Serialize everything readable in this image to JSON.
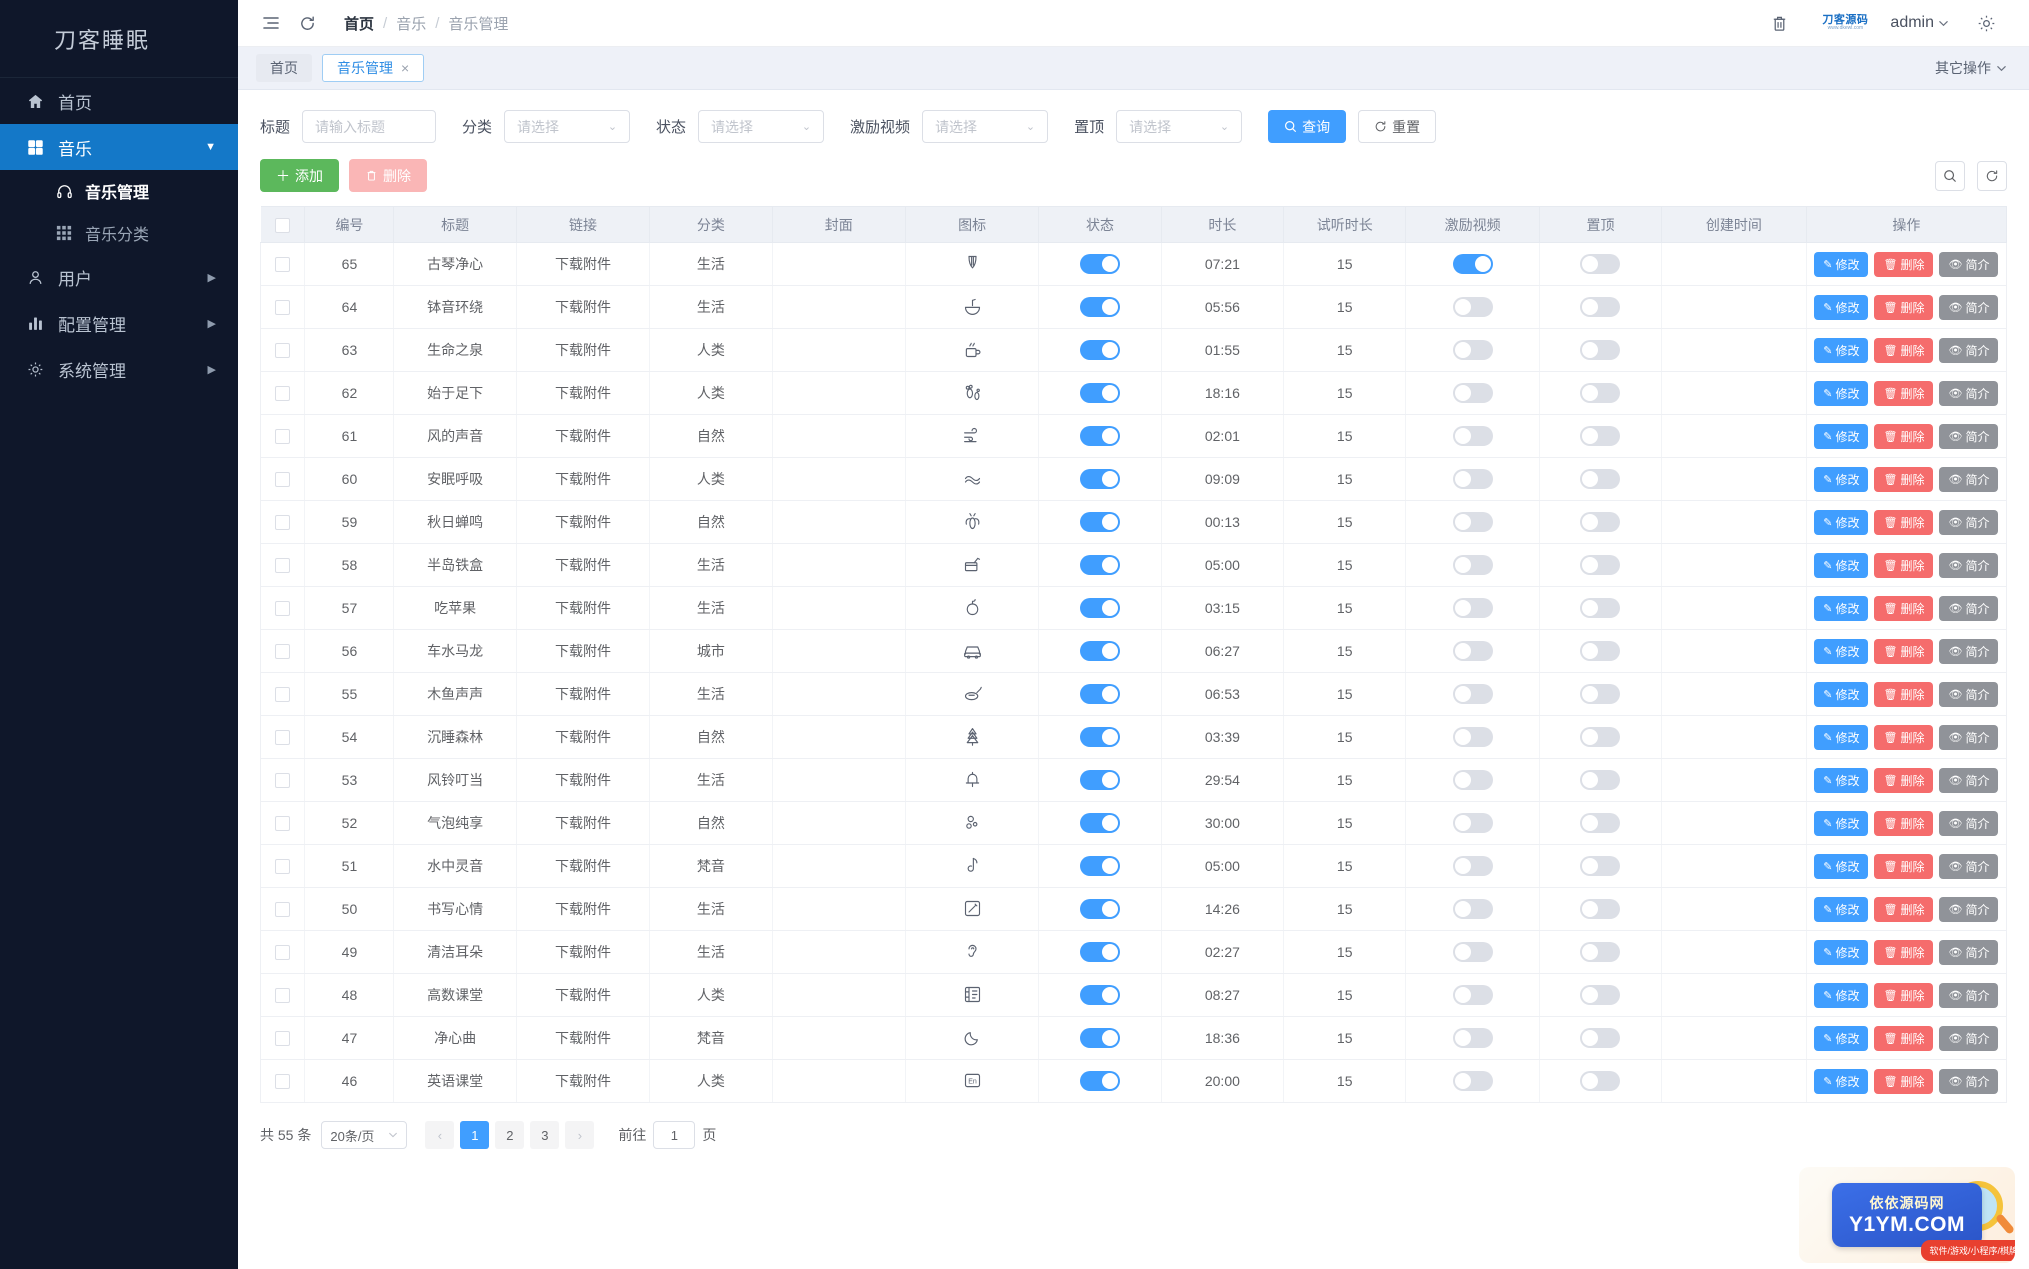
{
  "sidebar": {
    "brand": "刀客睡眠",
    "items": [
      {
        "label": "首页",
        "icon": "home-icon",
        "active": false,
        "arrow": ""
      },
      {
        "label": "音乐",
        "icon": "grid-icon",
        "active": true,
        "arrow": "▼"
      },
      {
        "label": "用户",
        "icon": "user-icon",
        "active": false,
        "arrow": "▶"
      },
      {
        "label": "配置管理",
        "icon": "chart-icon",
        "active": false,
        "arrow": "▶"
      },
      {
        "label": "系统管理",
        "icon": "gear-icon",
        "active": false,
        "arrow": "▶"
      }
    ],
    "sub_items": [
      {
        "label": "音乐管理",
        "icon": "headphone-icon",
        "current": true
      },
      {
        "label": "音乐分类",
        "icon": "grid-small-icon",
        "current": false
      }
    ]
  },
  "topbar": {
    "menu_icon": "hamburger-icon",
    "refresh_icon": "refresh-icon",
    "breadcrumb": [
      "首页",
      "音乐",
      "音乐管理"
    ],
    "separator": "/",
    "trash_icon": "trash-icon",
    "logo_text": "刀客源码",
    "logo_sub": "www.dkewl.com",
    "user_name": "admin",
    "settings_icon": "gear-icon"
  },
  "tabs": {
    "items": [
      {
        "label": "首页",
        "active": false,
        "closable": false
      },
      {
        "label": "音乐管理",
        "active": true,
        "closable": true
      }
    ],
    "close_glyph": "×",
    "other_actions": "其它操作",
    "other_actions_icon": "chevron-down-icon"
  },
  "filters": {
    "fields": [
      {
        "label": "标题",
        "type": "input",
        "value": "",
        "placeholder": "请输入标题"
      },
      {
        "label": "分类",
        "type": "select",
        "value": "",
        "placeholder": "请选择"
      },
      {
        "label": "状态",
        "type": "select",
        "value": "",
        "placeholder": "请选择"
      },
      {
        "label": "激励视频",
        "type": "select",
        "value": "",
        "placeholder": "请选择"
      },
      {
        "label": "置顶",
        "type": "select",
        "value": "",
        "placeholder": "请选择"
      }
    ],
    "search_label": "查询",
    "search_icon": "search-icon",
    "reset_label": "重置",
    "reset_icon": "refresh-icon"
  },
  "toolbar": {
    "add_label": "添加",
    "add_icon": "plus-icon",
    "delete_label": "删除",
    "delete_icon": "trash-icon",
    "search_round_icon": "search-icon",
    "refresh_round_icon": "refresh-icon"
  },
  "table": {
    "columns": [
      "编号",
      "标题",
      "链接",
      "分类",
      "封面",
      "图标",
      "状态",
      "时长",
      "试听时长",
      "激励视频",
      "置顶",
      "创建时间",
      "操作"
    ],
    "link_text": "下载附件",
    "ops": [
      {
        "label": "修改",
        "icon": "pencil-icon",
        "style": "op-edit"
      },
      {
        "label": "删除",
        "icon": "trash-icon",
        "style": "op-del"
      },
      {
        "label": "简介",
        "icon": "eye-icon",
        "style": "op-info"
      }
    ],
    "rows": [
      {
        "id": "65",
        "title": "古琴净心",
        "link": "下载附件",
        "category": "生活",
        "cover": "",
        "icon": "harp-icon",
        "status": true,
        "duration": "07:21",
        "trial": "15",
        "video": true,
        "top": false,
        "created": ""
      },
      {
        "id": "64",
        "title": "钵音环绕",
        "link": "下载附件",
        "category": "生活",
        "cover": "",
        "icon": "bowl-icon",
        "status": true,
        "duration": "05:56",
        "trial": "15",
        "video": false,
        "top": false,
        "created": ""
      },
      {
        "id": "63",
        "title": "生命之泉",
        "link": "下载附件",
        "category": "人类",
        "cover": "",
        "icon": "cup-icon",
        "status": true,
        "duration": "01:55",
        "trial": "15",
        "video": false,
        "top": false,
        "created": ""
      },
      {
        "id": "62",
        "title": "始于足下",
        "link": "下载附件",
        "category": "人类",
        "cover": "",
        "icon": "footprint-icon",
        "status": true,
        "duration": "18:16",
        "trial": "15",
        "video": false,
        "top": false,
        "created": ""
      },
      {
        "id": "61",
        "title": "风的声音",
        "link": "下载附件",
        "category": "自然",
        "cover": "",
        "icon": "wind-icon",
        "status": true,
        "duration": "02:01",
        "trial": "15",
        "video": false,
        "top": false,
        "created": ""
      },
      {
        "id": "60",
        "title": "安眠呼吸",
        "link": "下载附件",
        "category": "人类",
        "cover": "",
        "icon": "breath-icon",
        "status": true,
        "duration": "09:09",
        "trial": "15",
        "video": false,
        "top": false,
        "created": ""
      },
      {
        "id": "59",
        "title": "秋日蝉鸣",
        "link": "下载附件",
        "category": "自然",
        "cover": "",
        "icon": "cicada-icon",
        "status": true,
        "duration": "00:13",
        "trial": "15",
        "video": false,
        "top": false,
        "created": ""
      },
      {
        "id": "58",
        "title": "半岛铁盒",
        "link": "下载附件",
        "category": "生活",
        "cover": "",
        "icon": "box-icon",
        "status": true,
        "duration": "05:00",
        "trial": "15",
        "video": false,
        "top": false,
        "created": ""
      },
      {
        "id": "57",
        "title": "吃苹果",
        "link": "下载附件",
        "category": "生活",
        "cover": "",
        "icon": "apple-icon",
        "status": true,
        "duration": "03:15",
        "trial": "15",
        "video": false,
        "top": false,
        "created": ""
      },
      {
        "id": "56",
        "title": "车水马龙",
        "link": "下载附件",
        "category": "城市",
        "cover": "",
        "icon": "car-icon",
        "status": true,
        "duration": "06:27",
        "trial": "15",
        "video": false,
        "top": false,
        "created": ""
      },
      {
        "id": "55",
        "title": "木鱼声声",
        "link": "下载附件",
        "category": "生活",
        "cover": "",
        "icon": "woodfish-icon",
        "status": true,
        "duration": "06:53",
        "trial": "15",
        "video": false,
        "top": false,
        "created": ""
      },
      {
        "id": "54",
        "title": "沉睡森林",
        "link": "下载附件",
        "category": "自然",
        "cover": "",
        "icon": "forest-icon",
        "status": true,
        "duration": "03:39",
        "trial": "15",
        "video": false,
        "top": false,
        "created": ""
      },
      {
        "id": "53",
        "title": "风铃叮当",
        "link": "下载附件",
        "category": "生活",
        "cover": "",
        "icon": "bell-icon",
        "status": true,
        "duration": "29:54",
        "trial": "15",
        "video": false,
        "top": false,
        "created": ""
      },
      {
        "id": "52",
        "title": "气泡纯享",
        "link": "下载附件",
        "category": "自然",
        "cover": "",
        "icon": "bubble-icon",
        "status": true,
        "duration": "30:00",
        "trial": "15",
        "video": false,
        "top": false,
        "created": ""
      },
      {
        "id": "51",
        "title": "水中灵音",
        "link": "下载附件",
        "category": "梵音",
        "cover": "",
        "icon": "note-icon",
        "status": true,
        "duration": "05:00",
        "trial": "15",
        "video": false,
        "top": false,
        "created": ""
      },
      {
        "id": "50",
        "title": "书写心情",
        "link": "下载附件",
        "category": "生活",
        "cover": "",
        "icon": "write-icon",
        "status": true,
        "duration": "14:26",
        "trial": "15",
        "video": false,
        "top": false,
        "created": ""
      },
      {
        "id": "49",
        "title": "清洁耳朵",
        "link": "下载附件",
        "category": "生活",
        "cover": "",
        "icon": "ear-icon",
        "status": true,
        "duration": "02:27",
        "trial": "15",
        "video": false,
        "top": false,
        "created": ""
      },
      {
        "id": "48",
        "title": "高数课堂",
        "link": "下载附件",
        "category": "人类",
        "cover": "",
        "icon": "book-icon",
        "status": true,
        "duration": "08:27",
        "trial": "15",
        "video": false,
        "top": false,
        "created": ""
      },
      {
        "id": "47",
        "title": "净心曲",
        "link": "下载附件",
        "category": "梵音",
        "cover": "",
        "icon": "moon-icon",
        "status": true,
        "duration": "18:36",
        "trial": "15",
        "video": false,
        "top": false,
        "created": ""
      },
      {
        "id": "46",
        "title": "英语课堂",
        "link": "下载附件",
        "category": "人类",
        "cover": "",
        "icon": "en-icon",
        "status": true,
        "duration": "20:00",
        "trial": "15",
        "video": false,
        "top": false,
        "created": ""
      }
    ]
  },
  "pagination": {
    "total_text": "共 55 条",
    "page_size": "20条/页",
    "prev_glyph": "‹",
    "next_glyph": "›",
    "pages": [
      "1",
      "2",
      "3"
    ],
    "current_page": "1",
    "jump_prefix": "前往",
    "jump_value": "1",
    "jump_suffix": "页"
  },
  "watermark": {
    "cn": "依依源码网",
    "en": "Y1YM.COM",
    "tag": "软件/游戏/小程序/棋牌"
  },
  "colors": {
    "sidebar_bg": "#0f172a",
    "sidebar_active": "#1478c8",
    "primary": "#409eff",
    "success": "#5cb85c",
    "danger": "#f56c6c",
    "info": "#909399"
  }
}
